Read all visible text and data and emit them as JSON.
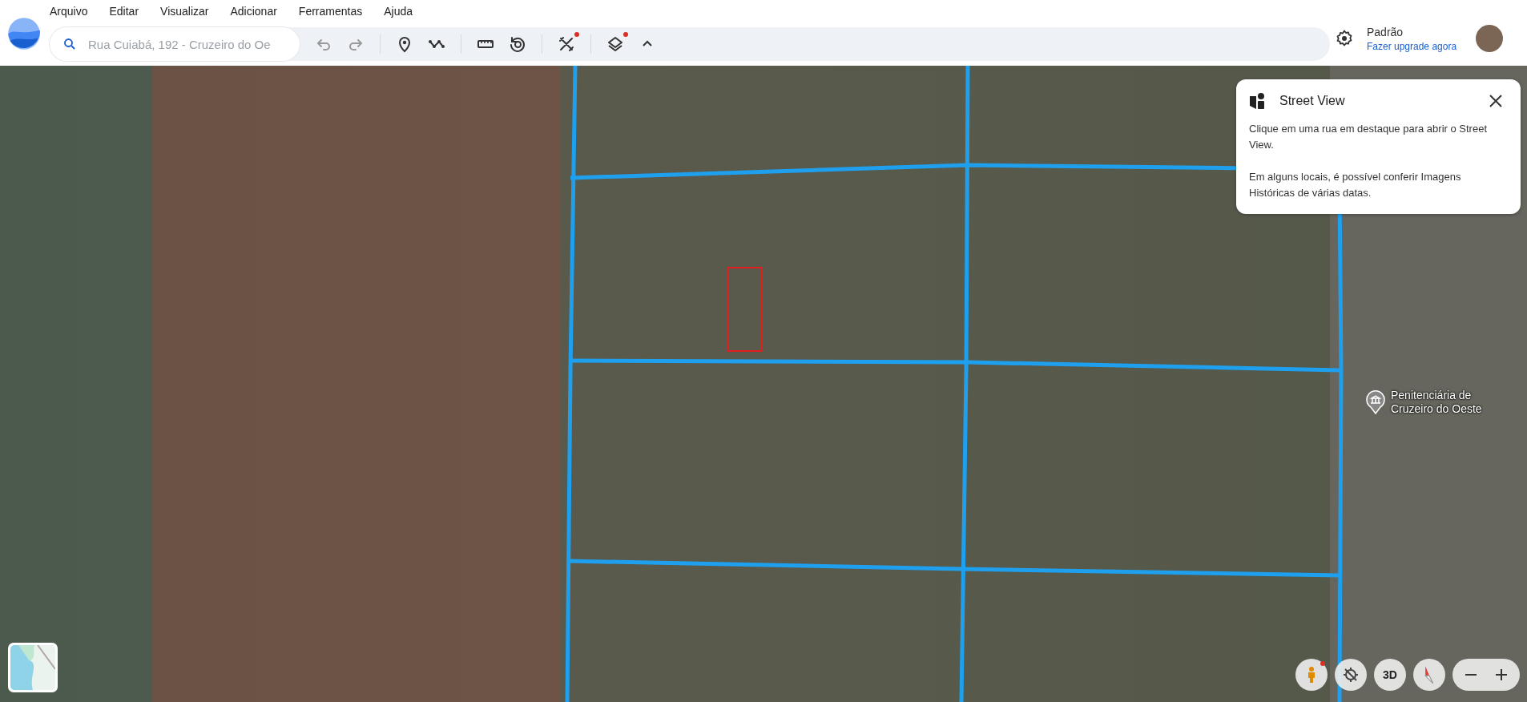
{
  "menu": [
    "Arquivo",
    "Editar",
    "Visualizar",
    "Adicionar",
    "Ferramentas",
    "Ajuda"
  ],
  "search": {
    "placeholder": "Rua Cuiabá, 192 - Cruzeiro do Oe"
  },
  "toolbar_groups": [
    [
      {
        "kind": "undo",
        "notification": false
      },
      {
        "kind": "redo",
        "notification": false
      }
    ],
    [
      {
        "kind": "placemark",
        "notification": false
      },
      {
        "kind": "path",
        "notification": false
      }
    ],
    [
      {
        "kind": "ruler",
        "notification": false
      },
      {
        "kind": "history",
        "notification": false
      }
    ],
    [
      {
        "kind": "tools",
        "notification": true
      }
    ],
    [
      {
        "kind": "layers",
        "notification": true
      },
      {
        "kind": "collapse",
        "notification": false
      }
    ]
  ],
  "account": {
    "plan": "Padrão",
    "upgrade_link": "Fazer upgrade agora"
  },
  "map": {
    "place_label": "Penitenciária de Cruzeiro do Oeste"
  },
  "street_view_popup": {
    "title": "Street View",
    "paragraphs": [
      "Clique em uma rua em destaque para abrir o Street View.",
      "Em alguns locais, é possível conferir Imagens Históricas de várias datas."
    ]
  },
  "map_controls": [
    {
      "kind": "pegman",
      "notification": true
    },
    {
      "kind": "location",
      "notification": false
    },
    {
      "kind": "tilt",
      "label": "3D",
      "notification": false
    },
    {
      "kind": "compass",
      "notification": false
    }
  ]
}
